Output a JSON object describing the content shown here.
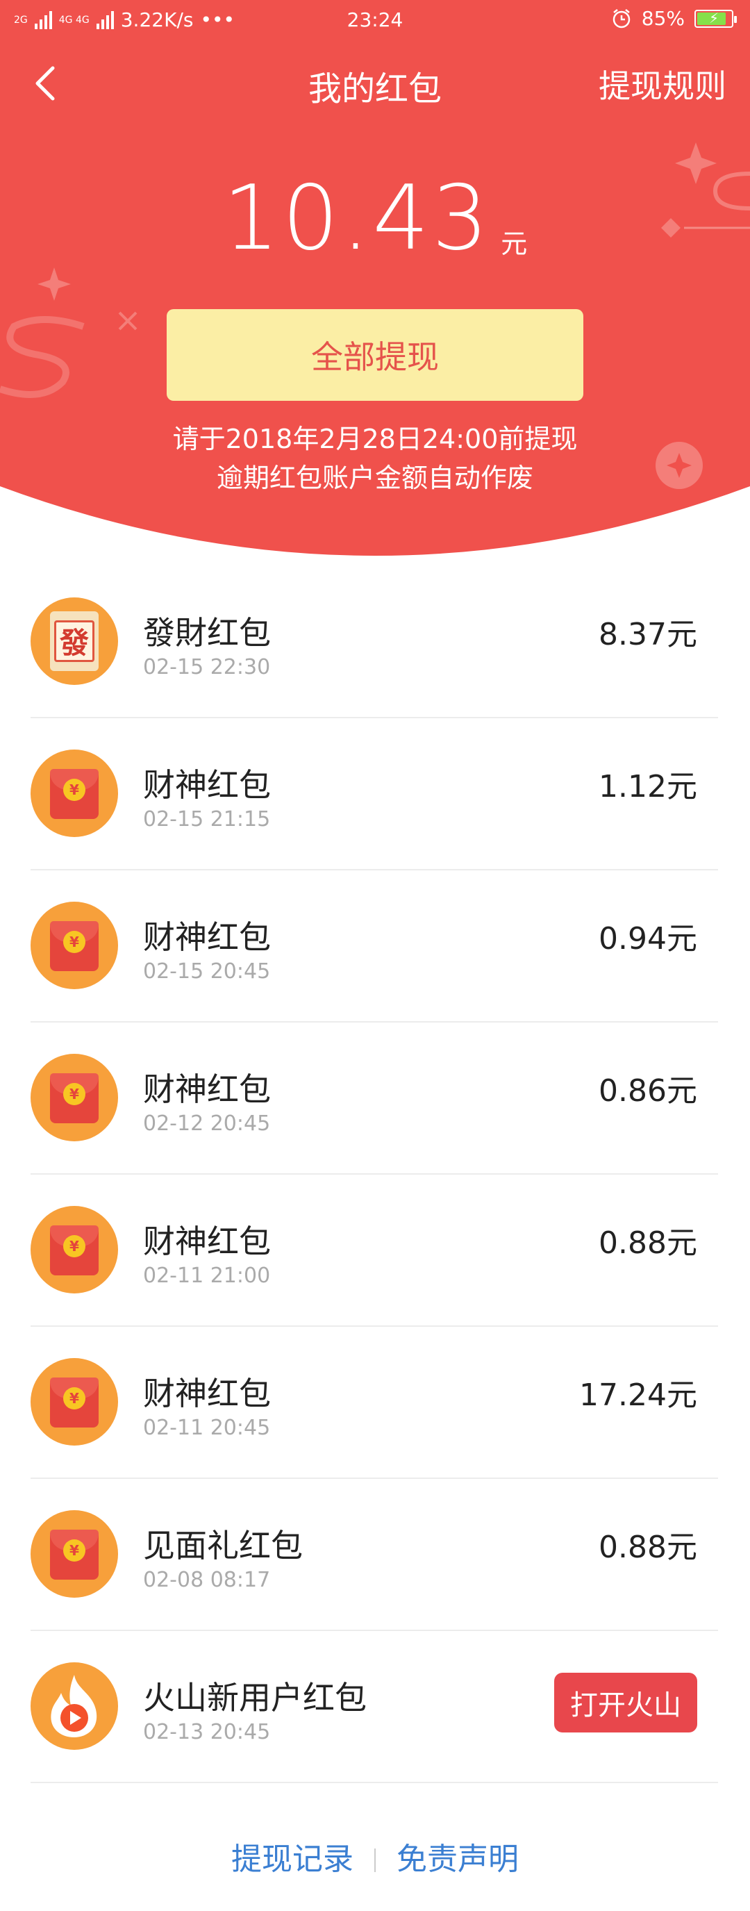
{
  "status_bar": {
    "left_network_a": "2G",
    "left_network_b": "4G 4G",
    "speed": "3.22K/s",
    "dots": "•••",
    "time": "23:24",
    "battery": "85%",
    "battery_level": 0.85
  },
  "nav": {
    "title": "我的红包",
    "rules": "提现规则"
  },
  "balance": {
    "amount": "10.43",
    "unit": "元"
  },
  "withdraw_button": "全部提现",
  "deadline": {
    "line1": "请于2018年2月28日24:00前提现",
    "line2": "逾期红包账户金额自动作废"
  },
  "items": [
    {
      "name": "發財红包",
      "time": "02-15 22:30",
      "value": "8.37元",
      "icon": "fa-card-icon"
    },
    {
      "name": "财神红包",
      "time": "02-15 21:15",
      "value": "1.12元",
      "icon": "red-envelope-icon"
    },
    {
      "name": "财神红包",
      "time": "02-15 20:45",
      "value": "0.94元",
      "icon": "red-envelope-icon"
    },
    {
      "name": "财神红包",
      "time": "02-12 20:45",
      "value": "0.86元",
      "icon": "red-envelope-icon"
    },
    {
      "name": "财神红包",
      "time": "02-11 21:00",
      "value": "0.88元",
      "icon": "red-envelope-icon"
    },
    {
      "name": "财神红包",
      "time": "02-11 20:45",
      "value": "17.24元",
      "icon": "red-envelope-icon"
    },
    {
      "name": "见面礼红包",
      "time": "02-08 08:17",
      "value": "0.88元",
      "icon": "red-envelope-icon"
    }
  ],
  "huoshan": {
    "name": "火山新用户红包",
    "time": "02-13 20:45",
    "button": "打开火山"
  },
  "fa_char": "發",
  "coin_char": "¥",
  "footer": {
    "records": "提现记录",
    "disclaimer": "免责声明"
  },
  "colors": {
    "hero_red": "#f0514c",
    "button_yellow": "#fbeea5",
    "link_blue": "#3b7fd2"
  }
}
